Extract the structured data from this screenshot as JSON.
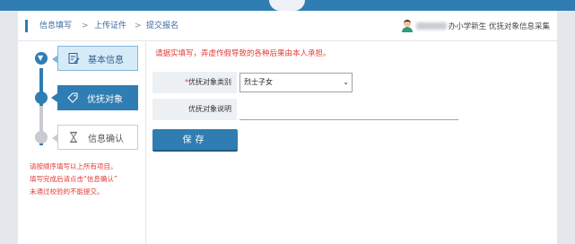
{
  "breadcrumb": {
    "step1": "信息填写",
    "sep": ">",
    "step2": "上传证件",
    "step3": "提交报名"
  },
  "user": {
    "label": "办小学新生 优抚对象信息采集"
  },
  "steps": [
    {
      "label": "基本信息",
      "icon": "document-edit-icon",
      "state": "visited"
    },
    {
      "label": "优抚对象",
      "icon": "tag-icon",
      "state": "current"
    },
    {
      "label": "信息确认",
      "icon": "hourglass-icon",
      "state": "pending"
    }
  ],
  "hint": {
    "line1": "请按顺序填写以上所有项目。",
    "line2": "填写完成后请点击“信息确认”",
    "line3": "未通过校验的不能提交。"
  },
  "form": {
    "notice": "请据实填写，弄虚作假导致的各种后果由本人承担。",
    "category": {
      "required_mark": "*",
      "label": "优抚对象类别",
      "value": "烈士子女"
    },
    "description": {
      "label": "优抚对象说明",
      "value": ""
    },
    "save_label": "保存"
  },
  "colors": {
    "primary": "#2f7db2",
    "warning": "#e53935",
    "background": "#e4e8ed"
  }
}
